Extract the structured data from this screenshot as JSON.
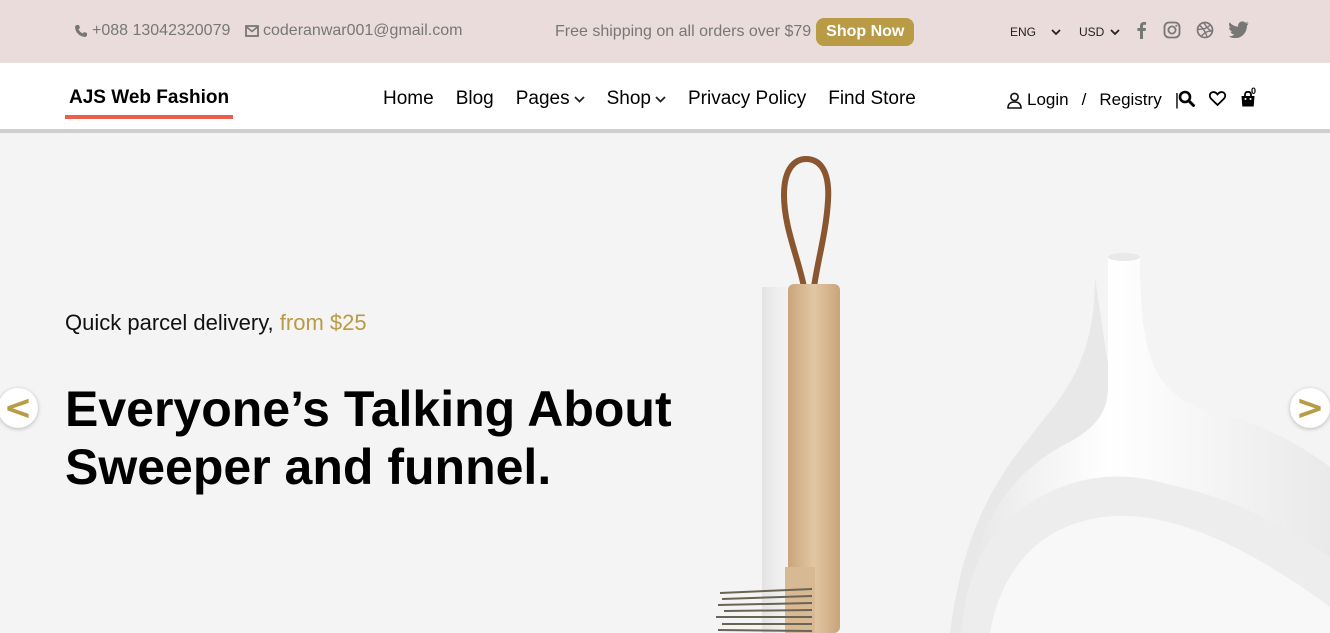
{
  "topbar": {
    "phone": "+088 13042320079",
    "email": "coderanwar001@gmail.com",
    "promo_text": "Free shipping on all orders over $79",
    "shop_now": "Shop Now",
    "language": "ENG",
    "currency": "USD",
    "social": [
      "facebook-icon",
      "instagram-icon",
      "dribbble-icon",
      "twitter-icon"
    ]
  },
  "header": {
    "logo": "AJS Web Fashion",
    "nav": [
      "Home",
      "Blog",
      "Pages",
      "Shop",
      "Privacy Policy",
      "Find Store"
    ],
    "login": "Login",
    "login_sep": "/",
    "registry": "Registry",
    "account_sep": "|",
    "cart_count": "0"
  },
  "hero": {
    "subtitle": "Quick parcel delivery,",
    "subtitle_price": "from $25",
    "title_line1": "Everyone’s Talking About",
    "title_line2": "Sweeper and funnel.",
    "prev": "<",
    "next": ">"
  },
  "colors": {
    "accent": "#b99a45",
    "topbar_bg": "#ebdcdc",
    "logo_underline": "#ee5c4a",
    "hero_bg": "#f4f4f4"
  }
}
